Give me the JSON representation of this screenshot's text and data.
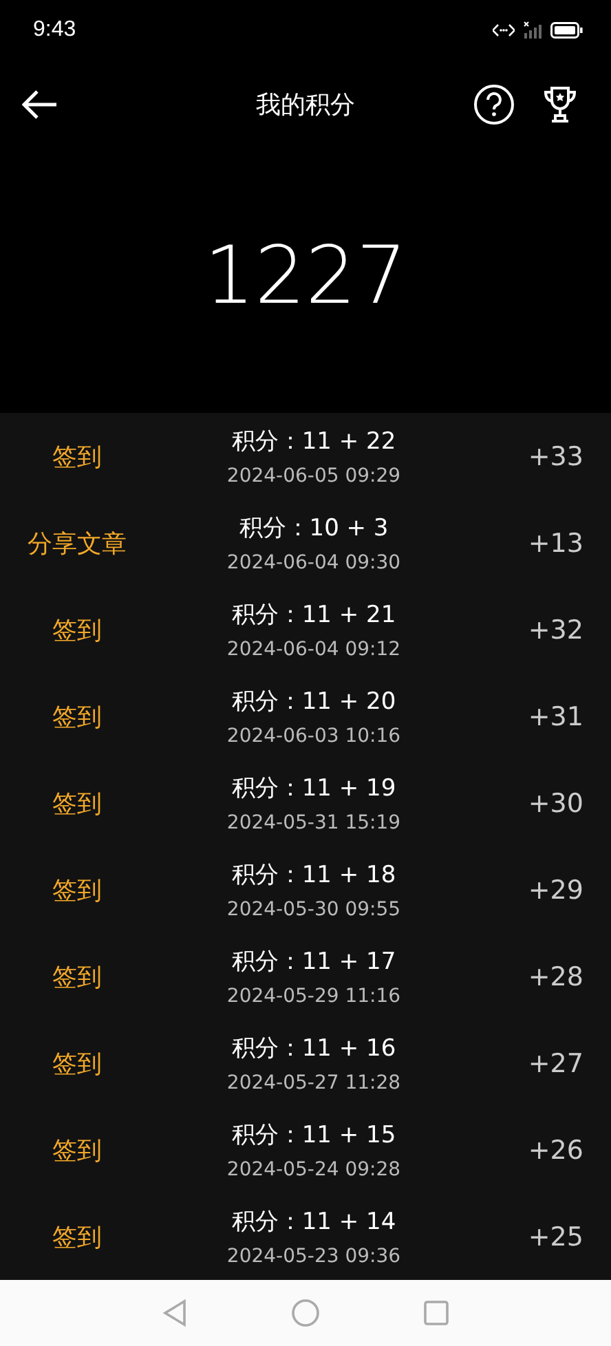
{
  "status_bar": {
    "time": "9:43"
  },
  "header": {
    "title": "我的积分"
  },
  "total": "1227",
  "records": [
    {
      "type": "签到",
      "points": "积分：11 + 22",
      "time": "2024-06-05 09:29",
      "delta": "+33"
    },
    {
      "type": "分享文章",
      "points": "积分：10 + 3",
      "time": "2024-06-04 09:30",
      "delta": "+13"
    },
    {
      "type": "签到",
      "points": "积分：11 + 21",
      "time": "2024-06-04 09:12",
      "delta": "+32"
    },
    {
      "type": "签到",
      "points": "积分：11 + 20",
      "time": "2024-06-03 10:16",
      "delta": "+31"
    },
    {
      "type": "签到",
      "points": "积分：11 + 19",
      "time": "2024-05-31 15:19",
      "delta": "+30"
    },
    {
      "type": "签到",
      "points": "积分：11 + 18",
      "time": "2024-05-30 09:55",
      "delta": "+29"
    },
    {
      "type": "签到",
      "points": "积分：11 + 17",
      "time": "2024-05-29 11:16",
      "delta": "+28"
    },
    {
      "type": "签到",
      "points": "积分：11 + 16",
      "time": "2024-05-27 11:28",
      "delta": "+27"
    },
    {
      "type": "签到",
      "points": "积分：11 + 15",
      "time": "2024-05-24 09:28",
      "delta": "+26"
    },
    {
      "type": "签到",
      "points": "积分：11 + 14",
      "time": "2024-05-23 09:36",
      "delta": "+25"
    }
  ]
}
